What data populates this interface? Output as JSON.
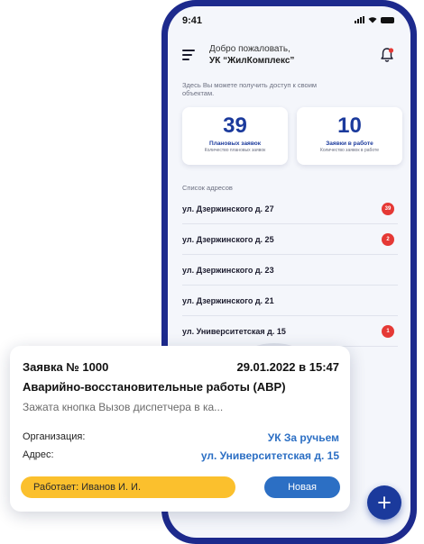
{
  "status_bar": {
    "time": "9:41"
  },
  "header": {
    "greeting": "Добро пожаловать,",
    "org_name": "УК “ЖилКомплекс”"
  },
  "hint": "Здесь Вы можете получить доступ к своим объектам.",
  "stats": [
    {
      "number": "39",
      "title": "Плановых заявок",
      "subtitle": "Количество плановых заявок"
    },
    {
      "number": "10",
      "title": "Заявки в работе",
      "subtitle": "Количество заявок в работе"
    }
  ],
  "addresses": {
    "heading": "Список адресов",
    "items": [
      {
        "label": "ул. Дзержинского д. 27",
        "badge": "39"
      },
      {
        "label": "ул. Дзержинского д.  25",
        "badge": "2"
      },
      {
        "label": "ул. Дзержинского д. 23",
        "badge": ""
      },
      {
        "label": "ул. Дзержинского д. 21",
        "badge": ""
      },
      {
        "label": "ул. Университетская д. 15",
        "badge": "1"
      }
    ]
  },
  "request": {
    "number": "Заявка № 1000",
    "date": "29.01.2022 в 15:47",
    "type": "Аварийно-восстановительные работы (АВР)",
    "description": "Зажата кнопка Вызов диспетчера в ка...",
    "org_label": "Организация:",
    "org_value": "УК За ручьем",
    "addr_label": "Адрес:",
    "addr_value": "ул. Университетская д. 15",
    "worker": "Работает: Иванов И. И.",
    "status": "Новая"
  },
  "colors": {
    "phone_frame": "#1d2a8d",
    "accent_blue": "#1b3a9c",
    "link_blue": "#2c6fc4",
    "badge_red": "#e53935",
    "worker_yellow": "#fbc02d"
  },
  "icons": {
    "menu": "menu-icon",
    "bell": "bell-icon",
    "add": "plus-icon",
    "watermark": "clock-watermark-icon"
  }
}
